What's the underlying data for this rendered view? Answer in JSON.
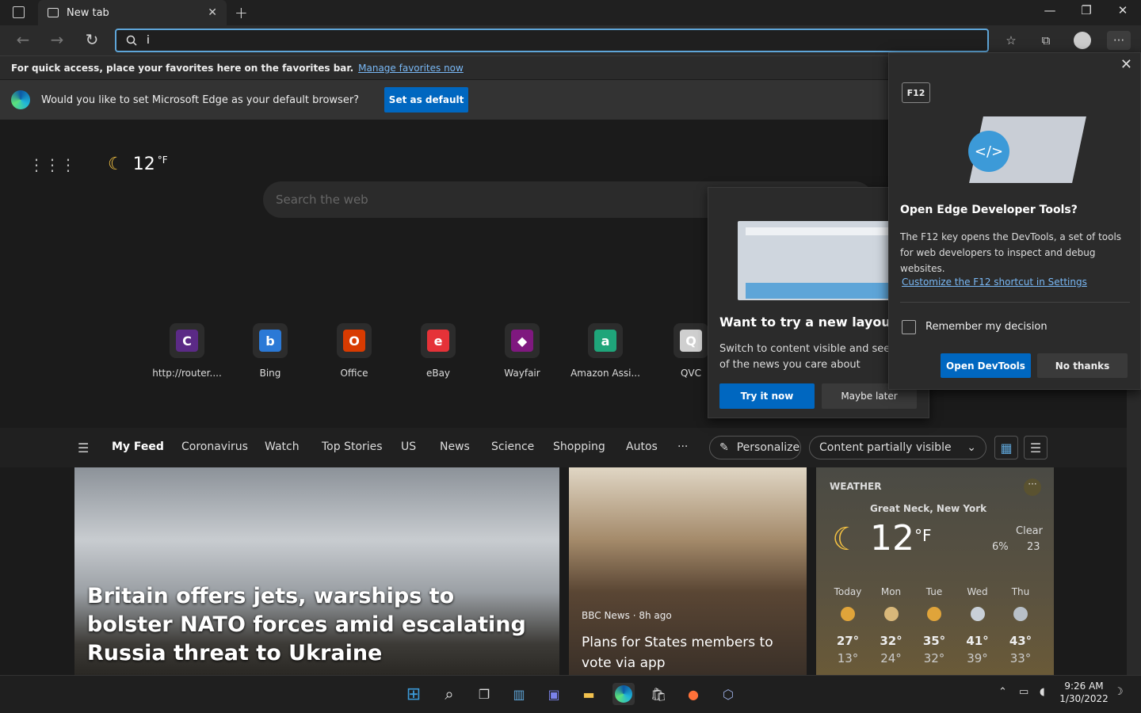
{
  "browser": {
    "tab_title": "New tab",
    "address_value": "i",
    "favorites_bar_text": "For quick access, place your favorites here on the favorites bar.",
    "favorites_bar_link": "Manage favorites now",
    "default_prompt": "Would you like to set Microsoft Edge as your default browser?",
    "set_default_button": "Set as default"
  },
  "newtab": {
    "weather_temp": "12",
    "weather_unit": "°F",
    "search_placeholder": "Search the web",
    "quick_links": [
      {
        "label": "http://router....",
        "glyph": "C",
        "color": "#5b2a86"
      },
      {
        "label": "Bing",
        "glyph": "b",
        "color": "#2b79d6"
      },
      {
        "label": "Office",
        "glyph": "O",
        "color": "#d83b01"
      },
      {
        "label": "eBay",
        "glyph": "e",
        "color": "#e53238"
      },
      {
        "label": "Wayfair",
        "glyph": "◆",
        "color": "#7f187f"
      },
      {
        "label": "Amazon Assi...",
        "glyph": "a",
        "color": "#1fa57a"
      },
      {
        "label": "QVC",
        "glyph": "Q",
        "color": "#cfcfcf"
      }
    ]
  },
  "feed": {
    "tabs": [
      "My Feed",
      "Coronavirus",
      "Watch",
      "Top Stories",
      "US",
      "News",
      "Science",
      "Shopping",
      "Autos",
      "···"
    ],
    "personalize": "Personalize",
    "visibility": "Content partially visible"
  },
  "cards": {
    "main_headline": "Britain offers jets, warships to bolster NATO forces amid escalating Russia threat to Ukraine",
    "second_source": "BBC News · 8h ago",
    "second_headline": "Plans for States members to vote via app"
  },
  "weather_card": {
    "label": "WEATHER",
    "location": "Great Neck, New York",
    "temp": "12",
    "unit": "°F",
    "condition": "Clear",
    "precip": "6%",
    "wind": "23",
    "forecast": [
      {
        "day": "Today",
        "hi": "27°",
        "lo": "13°"
      },
      {
        "day": "Mon",
        "hi": "32°",
        "lo": "24°"
      },
      {
        "day": "Tue",
        "hi": "35°",
        "lo": "32°"
      },
      {
        "day": "Wed",
        "hi": "41°",
        "lo": "39°"
      },
      {
        "day": "Thu",
        "hi": "43°",
        "lo": "33°"
      }
    ]
  },
  "layout_popup": {
    "title": "Want to try a new layout?",
    "body": "Switch to content visible and see more of the news you care about",
    "try_button": "Try it now",
    "later_button": "Maybe later"
  },
  "devtools_popup": {
    "key": "F12",
    "title": "Open Edge Developer Tools?",
    "body": "The F12 key opens the DevTools, a set of tools for web developers to inspect and debug websites.",
    "link": "Customize the F12 shortcut in Settings",
    "remember": "Remember my decision",
    "open_button": "Open DevTools",
    "no_button": "No thanks"
  },
  "taskbar": {
    "time": "9:26 AM",
    "date": "1/30/2022"
  }
}
